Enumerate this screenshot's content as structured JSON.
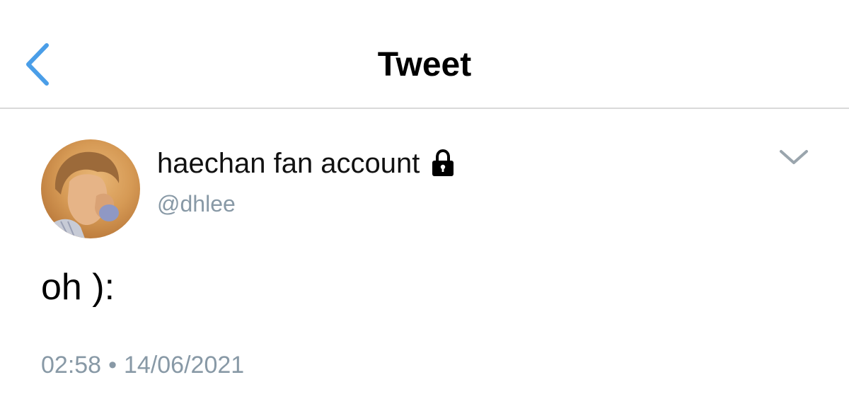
{
  "nav": {
    "title": "Tweet",
    "back_icon": "chevron-left-icon",
    "accent_color": "#4a9ee8"
  },
  "tweet": {
    "display_name": "haechan fan account",
    "protected_icon": "lock-icon",
    "handle": "@dhlee",
    "menu_icon": "chevron-down-icon",
    "text": "oh ):",
    "time": "02:58",
    "separator": "•",
    "date": "14/06/2021"
  }
}
